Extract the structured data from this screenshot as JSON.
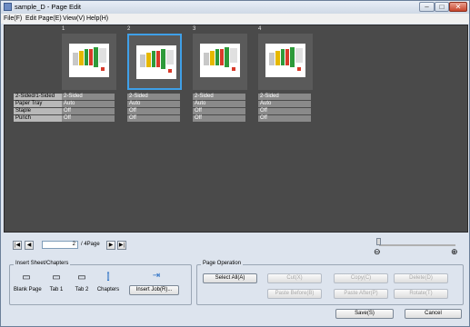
{
  "window": {
    "title": "sample_D - Page Edit"
  },
  "menu": [
    "File(F)",
    "Edit Page(E)",
    "View(V)",
    "Help(H)"
  ],
  "pages": [
    {
      "num": "1",
      "selected": false,
      "sided": "2-Sided",
      "tray": "Auto",
      "staple": "Off",
      "punch": "Off"
    },
    {
      "num": "2",
      "selected": true,
      "sided": "2-Sided",
      "tray": "Auto",
      "staple": "Off",
      "punch": "Off"
    },
    {
      "num": "3",
      "selected": false,
      "sided": "2-Sided",
      "tray": "Auto",
      "staple": "Off",
      "punch": "Off"
    },
    {
      "num": "4",
      "selected": false,
      "sided": "2-Sided",
      "tray": "Auto",
      "staple": "Off",
      "punch": "Off"
    }
  ],
  "attr_labels": {
    "sided": "2-Sided/1-Sided",
    "tray": "Paper Tray",
    "staple": "Staple",
    "punch": "Punch"
  },
  "navigation": {
    "current_page": "2",
    "total": "/ 4Page"
  },
  "insert_group": {
    "title": "Insert Sheet/Chapters",
    "items": [
      "Blank Page",
      "Tab 1",
      "Tab 2",
      "Chapters"
    ],
    "insert_job": "Insert Job(R)..."
  },
  "page_operation": {
    "title": "Page Operation",
    "select_all": "Select All(A)",
    "cut": "Cut(X)",
    "copy": "Copy(C)",
    "delete": "Delete(D)",
    "paste_before": "Paste Before(B)",
    "paste_after": "Paste After(P)",
    "rotate": "Rotate(T)"
  },
  "footer": {
    "save": "Save(S)",
    "cancel": "Cancel"
  }
}
